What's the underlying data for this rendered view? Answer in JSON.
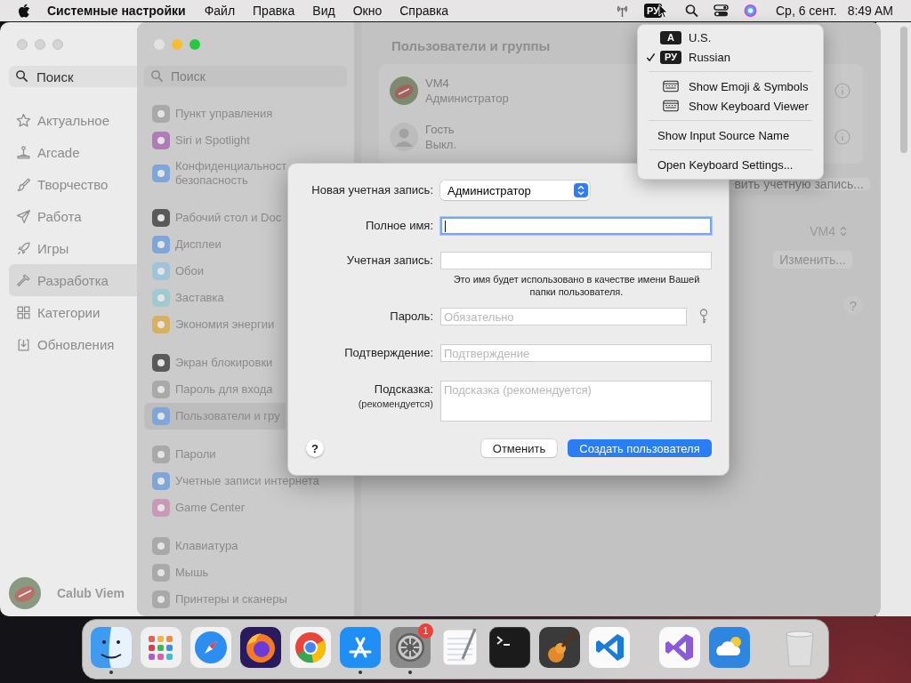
{
  "menu_bar": {
    "app_name": "Системные настройки",
    "items": [
      "Файл",
      "Правка",
      "Вид",
      "Окно",
      "Справка"
    ],
    "input_source": "РУ",
    "date": "Ср, 6 сент.",
    "time": "8:49 AM"
  },
  "app_store": {
    "search": {
      "placeholder": "Поиск"
    },
    "sidebar": [
      {
        "label": "Актуальное",
        "selected": false
      },
      {
        "label": "Arcade",
        "selected": false
      },
      {
        "label": "Творчество",
        "selected": false
      },
      {
        "label": "Работа",
        "selected": false
      },
      {
        "label": "Игры",
        "selected": false
      },
      {
        "label": "Разработка",
        "selected": true
      },
      {
        "label": "Категории",
        "selected": false
      },
      {
        "label": "Обновления",
        "selected": false
      }
    ],
    "user_name": "Calub Viem"
  },
  "settings": {
    "search": {
      "placeholder": "Поиск"
    },
    "sidebar_groups": [
      [
        {
          "label": "Пункт управления",
          "color": "#a9a9a9",
          "selected": false
        },
        {
          "label": "Siri и Spotlight",
          "color": "#b07cb8",
          "selected": false
        },
        {
          "label": "Конфиденциальност\nбезопасность",
          "color": "#7fa6d8",
          "selected": false
        }
      ],
      [
        {
          "label": "Рабочий стол и Doc",
          "color": "#5a5a5a",
          "selected": false
        },
        {
          "label": "Дисплеи",
          "color": "#7fa6d8",
          "selected": false
        },
        {
          "label": "Обои",
          "color": "#9fc3d8",
          "selected": false
        },
        {
          "label": "Заставка",
          "color": "#9fcad0",
          "selected": false
        },
        {
          "label": "Экономия энергии",
          "color": "#d8b060",
          "selected": false
        }
      ],
      [
        {
          "label": "Экран блокировки",
          "color": "#5a5a5a",
          "selected": false
        },
        {
          "label": "Пароль для входа",
          "color": "#a9a9a9",
          "selected": false
        },
        {
          "label": "Пользователи и гру",
          "color": "#7fa6d8",
          "selected": true
        }
      ],
      [
        {
          "label": "Пароли",
          "color": "#a9a9a9",
          "selected": false
        },
        {
          "label": "Учетные записи интернета",
          "color": "#7fa6d8",
          "selected": false
        },
        {
          "label": "Game Center",
          "color": "#c99ab8",
          "selected": false
        }
      ],
      [
        {
          "label": "Клавиатура",
          "color": "#a9a9a9",
          "selected": false
        },
        {
          "label": "Мышь",
          "color": "#a9a9a9",
          "selected": false
        },
        {
          "label": "Принтеры и сканеры",
          "color": "#a9a9a9",
          "selected": false
        }
      ]
    ],
    "title": "Пользователи и группы",
    "users": [
      {
        "name": "VM4",
        "role": "Администратор",
        "kind": "photo"
      },
      {
        "name": "Гость",
        "role": "Выкл.",
        "kind": "guest"
      }
    ],
    "add_account_button": "вить учетную запись...",
    "auto_login_value": "VM4",
    "edit_button": "Изменить...",
    "help": "?"
  },
  "dialog": {
    "account_type_label": "Новая учетная запись:",
    "account_type_value": "Администратор",
    "fields": [
      {
        "label": "Полное имя:",
        "kind": "text",
        "focused": true
      },
      {
        "label": "Учетная запись:",
        "kind": "text",
        "focused": false,
        "note": "Это имя будет использовано в качестве имени Вашей папки пользователя."
      },
      {
        "label": "Пароль:",
        "kind": "password",
        "placeholder": "Обязательно",
        "focused": false
      },
      {
        "label": "Подтверждение:",
        "kind": "text",
        "placeholder": "Подтверждение",
        "focused": false
      },
      {
        "label": "Подсказка:",
        "sublabel": "(рекомендуется)",
        "kind": "textarea",
        "placeholder": "Подсказка (рекомендуется)",
        "focused": false
      }
    ],
    "help": "?",
    "cancel_button": "Отменить",
    "create_button": "Создать пользователя"
  },
  "input_menu": {
    "sources": [
      {
        "badge": "A",
        "name": "U.S.",
        "selected": false
      },
      {
        "badge": "РУ",
        "name": "Russian",
        "selected": true
      }
    ],
    "tools": [
      "Show Emoji & Symbols",
      "Show Keyboard Viewer"
    ],
    "show_name": "Show Input Source Name",
    "open_settings": "Open Keyboard Settings..."
  },
  "dock": {
    "apps": [
      {
        "running": true
      },
      {
        "running": false
      },
      {
        "running": false
      },
      {
        "running": false
      },
      {
        "running": false
      },
      {
        "running": true
      },
      {
        "running": true,
        "badge": "1"
      },
      {
        "running": false
      },
      {
        "running": false
      },
      {
        "running": false
      },
      {
        "running": false
      },
      {
        "running": false
      },
      {
        "running": false
      },
      {
        "running": false
      }
    ]
  }
}
